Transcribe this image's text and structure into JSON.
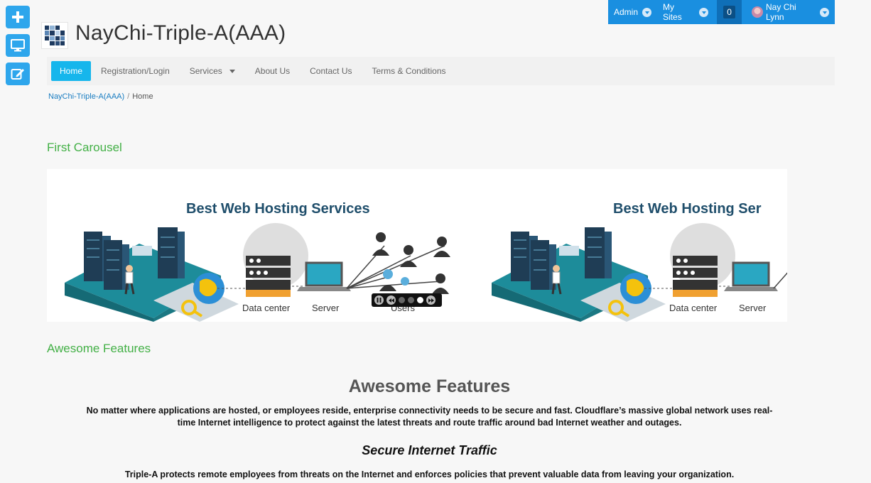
{
  "toolbar": {
    "buttons": [
      {
        "icon": "plus-icon"
      },
      {
        "icon": "desktop-icon"
      },
      {
        "icon": "edit-icon"
      }
    ]
  },
  "adminbar": {
    "admin_label": "Admin",
    "sites_label": "My Sites",
    "notification_count": "0",
    "user_name": "Nay Chi Lynn"
  },
  "site": {
    "title": "NayChi-Triple-A(AAA)"
  },
  "nav": {
    "items": [
      {
        "label": "Home",
        "active": true
      },
      {
        "label": "Registration/Login"
      },
      {
        "label": "Services",
        "has_dropdown": true
      },
      {
        "label": "About Us"
      },
      {
        "label": "Contact Us"
      },
      {
        "label": "Terms & Conditions"
      }
    ]
  },
  "breadcrumb": {
    "root": "NayChi-Triple-A(AAA)",
    "separator": "/",
    "current": "Home"
  },
  "carousel": {
    "heading": "First Carousel",
    "slide_title": "Best Web Hosting Services",
    "slide_title_cut": "Best Web Hosting Ser",
    "captions": [
      "Data center",
      "Server",
      "Users"
    ],
    "dot_count": 3,
    "active_dot": 2
  },
  "features": {
    "section_heading": "Awesome Features",
    "heading": "Awesome Features",
    "intro": "No matter where applications are hosted, or employees reside, enterprise connectivity needs to be secure and fast. Cloudflare’s massive global network uses real-time Internet intelligence to protect against the latest threats and route traffic around bad Internet weather and outages.",
    "sub_heading": "Secure Internet Traffic",
    "sub_text": "Triple-A protects remote employees from threats on the Internet and enforces policies that prevent valuable data from leaving your organization."
  },
  "colors": {
    "accent_blue": "#16b6ec",
    "admin_bar": "#1a8fe0",
    "section_green": "#43b046",
    "slide_title": "#1f4e6b"
  }
}
